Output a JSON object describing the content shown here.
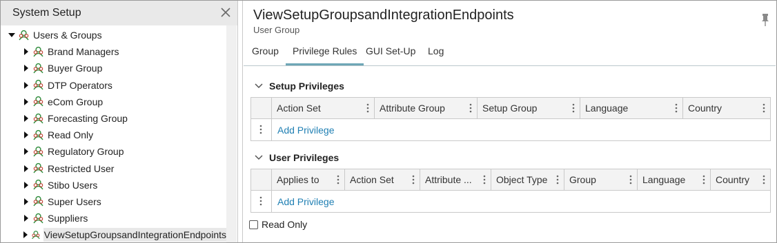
{
  "left_panel": {
    "title": "System Setup",
    "tree": {
      "root": {
        "label": "Users & Groups",
        "expanded": true
      },
      "children": [
        {
          "label": "Brand Managers"
        },
        {
          "label": "Buyer Group"
        },
        {
          "label": "DTP Operators"
        },
        {
          "label": "eCom Group"
        },
        {
          "label": "Forecasting Group"
        },
        {
          "label": "Read Only"
        },
        {
          "label": "Regulatory Group"
        },
        {
          "label": "Restricted User"
        },
        {
          "label": "Stibo Users"
        },
        {
          "label": "Super Users"
        },
        {
          "label": "Suppliers"
        },
        {
          "label": "ViewSetupGroupsandIntegrationEndpoints",
          "selected": true
        }
      ]
    }
  },
  "main": {
    "title": "ViewSetupGroupsandIntegrationEndpoints",
    "subtitle": "User Group",
    "tabs": [
      {
        "label": "Group"
      },
      {
        "label": "Privilege Rules",
        "active": true
      },
      {
        "label": "GUI Set-Up"
      },
      {
        "label": "Log"
      }
    ],
    "setup_privileges": {
      "heading": "Setup Privileges",
      "columns": [
        "Action Set",
        "Attribute Group",
        "Setup Group",
        "Language",
        "Country"
      ],
      "add_label": "Add Privilege"
    },
    "user_privileges": {
      "heading": "User Privileges",
      "columns": [
        "Applies to",
        "Action Set",
        "Attribute ...",
        "Object Type",
        "Group",
        "Language",
        "Country"
      ],
      "add_label": "Add Privilege"
    },
    "read_only": {
      "label": "Read Only",
      "checked": false
    }
  },
  "colors": {
    "link": "#1f7fb3",
    "tab_active": "#6ea6b6",
    "icon_green": "#2e8b3a",
    "icon_red": "#c0392b"
  },
  "icons": {
    "close": "close-icon",
    "pin": "pin-icon",
    "group": "user-group-icon",
    "expand": "triangle-right-icon",
    "collapse": "triangle-down-icon",
    "section": "chevron-down-icon",
    "column_menu": "kebab-menu-icon"
  }
}
